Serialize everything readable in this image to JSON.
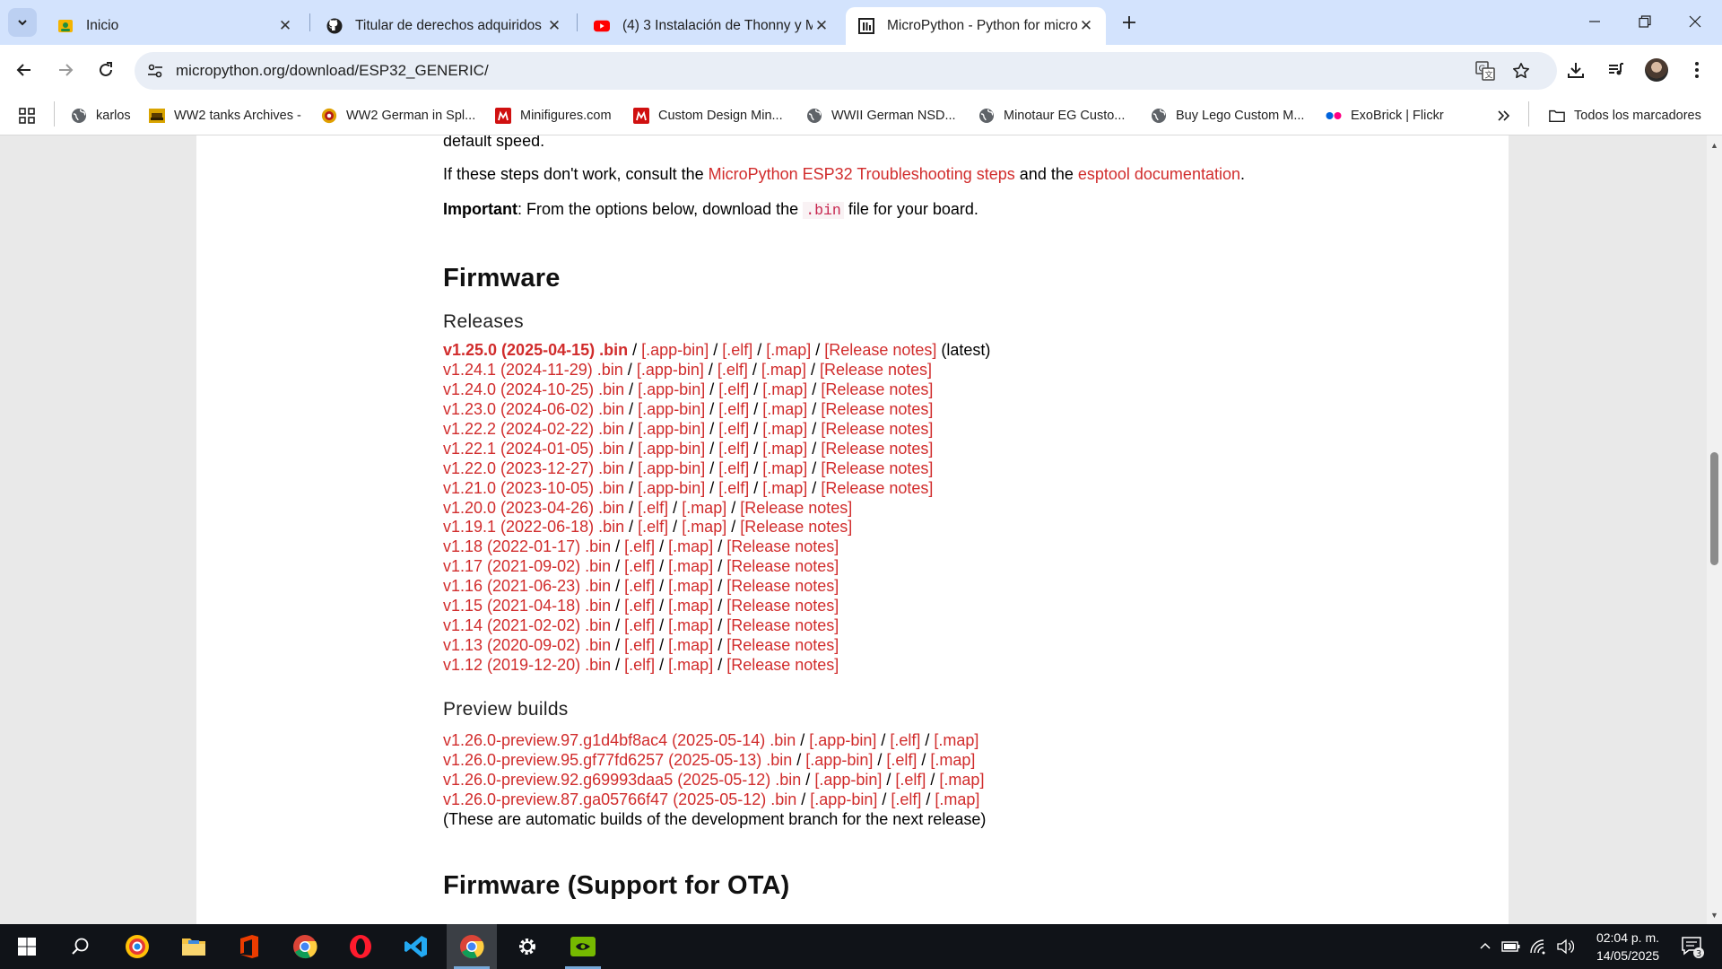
{
  "browser": {
    "tabs": [
      {
        "title": "Inicio",
        "icon": "contacts-icon"
      },
      {
        "title": "Titular de derechos adquiridos",
        "icon": "github-icon"
      },
      {
        "title": "(4) 3 Instalación de Thonny y M",
        "icon": "youtube-icon"
      },
      {
        "title": "MicroPython - Python for micro",
        "icon": "micropython-icon",
        "active": true
      }
    ],
    "address": "micropython.org/download/ESP32_GENERIC/",
    "bookmarks": [
      {
        "label": "karlos"
      },
      {
        "label": "WW2 tanks Archives -"
      },
      {
        "label": "WW2 German in Spl..."
      },
      {
        "label": "Minifigures.com"
      },
      {
        "label": "Custom Design Min..."
      },
      {
        "label": "WWII German NSD..."
      },
      {
        "label": "Minotaur EG Custo..."
      },
      {
        "label": "Buy Lego Custom M..."
      },
      {
        "label": "ExoBrick | Flickr"
      }
    ],
    "all_bookmarks": "Todos los marcadores"
  },
  "page": {
    "top_fragment": "default speed.",
    "troubleshoot": {
      "pre": "If these steps don't work, consult the ",
      "link1": "MicroPython ESP32 Troubleshooting steps",
      "mid": " and the ",
      "link2": "esptool documentation",
      "post": "."
    },
    "important": {
      "label": "Important",
      "pre": ": From the options below, download the ",
      "code": ".bin",
      "post": " file for your board."
    },
    "firmware_heading": "Firmware",
    "releases_heading": "Releases",
    "releases": [
      {
        "version": "v1.25.0 (2025-04-15) .bin",
        "links": [
          "[.app-bin]",
          "[.elf]",
          "[.map]",
          "[Release notes]"
        ],
        "suffix": " (latest)"
      },
      {
        "version": "v1.24.1 (2024-11-29) .bin",
        "links": [
          "[.app-bin]",
          "[.elf]",
          "[.map]",
          "[Release notes]"
        ]
      },
      {
        "version": "v1.24.0 (2024-10-25) .bin",
        "links": [
          "[.app-bin]",
          "[.elf]",
          "[.map]",
          "[Release notes]"
        ]
      },
      {
        "version": "v1.23.0 (2024-06-02) .bin",
        "links": [
          "[.app-bin]",
          "[.elf]",
          "[.map]",
          "[Release notes]"
        ]
      },
      {
        "version": "v1.22.2 (2024-02-22) .bin",
        "links": [
          "[.app-bin]",
          "[.elf]",
          "[.map]",
          "[Release notes]"
        ]
      },
      {
        "version": "v1.22.1 (2024-01-05) .bin",
        "links": [
          "[.app-bin]",
          "[.elf]",
          "[.map]",
          "[Release notes]"
        ]
      },
      {
        "version": "v1.22.0 (2023-12-27) .bin",
        "links": [
          "[.app-bin]",
          "[.elf]",
          "[.map]",
          "[Release notes]"
        ]
      },
      {
        "version": "v1.21.0 (2023-10-05) .bin",
        "links": [
          "[.app-bin]",
          "[.elf]",
          "[.map]",
          "[Release notes]"
        ]
      },
      {
        "version": "v1.20.0 (2023-04-26) .bin",
        "links": [
          "[.elf]",
          "[.map]",
          "[Release notes]"
        ]
      },
      {
        "version": "v1.19.1 (2022-06-18) .bin",
        "links": [
          "[.elf]",
          "[.map]",
          "[Release notes]"
        ]
      },
      {
        "version": "v1.18 (2022-01-17) .bin",
        "links": [
          "[.elf]",
          "[.map]",
          "[Release notes]"
        ]
      },
      {
        "version": "v1.17 (2021-09-02) .bin",
        "links": [
          "[.elf]",
          "[.map]",
          "[Release notes]"
        ]
      },
      {
        "version": "v1.16 (2021-06-23) .bin",
        "links": [
          "[.elf]",
          "[.map]",
          "[Release notes]"
        ]
      },
      {
        "version": "v1.15 (2021-04-18) .bin",
        "links": [
          "[.elf]",
          "[.map]",
          "[Release notes]"
        ]
      },
      {
        "version": "v1.14 (2021-02-02) .bin",
        "links": [
          "[.elf]",
          "[.map]",
          "[Release notes]"
        ]
      },
      {
        "version": "v1.13 (2020-09-02) .bin",
        "links": [
          "[.elf]",
          "[.map]",
          "[Release notes]"
        ]
      },
      {
        "version": "v1.12 (2019-12-20) .bin",
        "links": [
          "[.elf]",
          "[.map]",
          "[Release notes]"
        ]
      }
    ],
    "preview_heading": "Preview builds",
    "previews": [
      {
        "version": "v1.26.0-preview.97.g1d4bf8ac4 (2025-05-14) .bin",
        "links": [
          "[.app-bin]",
          "[.elf]",
          "[.map]"
        ]
      },
      {
        "version": "v1.26.0-preview.95.gf77fd6257 (2025-05-13) .bin",
        "links": [
          "[.app-bin]",
          "[.elf]",
          "[.map]"
        ]
      },
      {
        "version": "v1.26.0-preview.92.g69993daa5 (2025-05-12) .bin",
        "links": [
          "[.app-bin]",
          "[.elf]",
          "[.map]"
        ]
      },
      {
        "version": "v1.26.0-preview.87.ga05766f47 (2025-05-12) .bin",
        "links": [
          "[.app-bin]",
          "[.elf]",
          "[.map]"
        ]
      }
    ],
    "preview_note": "(These are automatic builds of the development branch for the next release)",
    "ota_heading": "Firmware (Support for OTA)",
    "link_color": "#d12c2c"
  },
  "taskbar": {
    "time": "02:04 p. m.",
    "date": "14/05/2025",
    "notification_count": "3"
  }
}
